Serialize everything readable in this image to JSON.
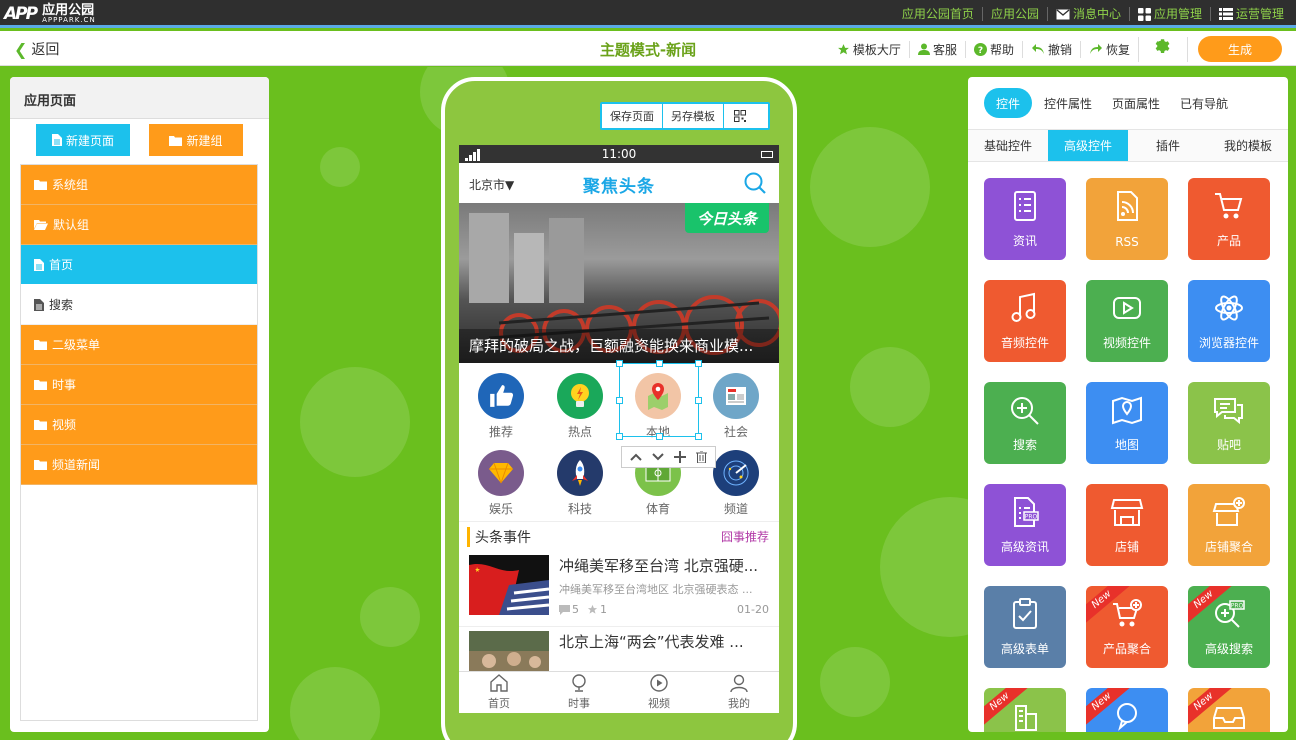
{
  "topbar": {
    "logo_mark": "APP",
    "logo_name": "应用公园",
    "logo_sub": "APPPARK.CN",
    "nav": [
      {
        "label": "应用公园首页",
        "icon": ""
      },
      {
        "label": "应用公园",
        "icon": ""
      },
      {
        "label": "消息中心",
        "icon": "envelope-icon"
      },
      {
        "label": "应用管理",
        "icon": "grid-icon"
      },
      {
        "label": "运营管理",
        "icon": "list-icon"
      }
    ]
  },
  "toolbar": {
    "back_label": "返回",
    "page_title": "主题模式-新闻",
    "tools": [
      {
        "label": "模板大厅",
        "icon": "star-icon"
      },
      {
        "label": "客服",
        "icon": "person-icon"
      },
      {
        "label": "帮助",
        "icon": "question-icon"
      },
      {
        "label": "撤销",
        "icon": "undo-icon"
      },
      {
        "label": "恢复",
        "icon": "redo-icon"
      }
    ],
    "generate_label": "生成"
  },
  "left_panel": {
    "title": "应用页面",
    "new_page_label": "新建页面",
    "new_group_label": "新建组",
    "items": [
      {
        "label": "系统组",
        "kind": "group"
      },
      {
        "label": "默认组",
        "kind": "group-open"
      },
      {
        "label": "首页",
        "kind": "page-active"
      },
      {
        "label": "搜索",
        "kind": "page"
      },
      {
        "label": "二级菜单",
        "kind": "group"
      },
      {
        "label": "时事",
        "kind": "group"
      },
      {
        "label": "视频",
        "kind": "group"
      },
      {
        "label": "频道新闻",
        "kind": "group"
      }
    ]
  },
  "phone": {
    "toolbar": {
      "save_label": "保存页面",
      "save_template_label": "另存模板"
    },
    "status_time": "11:00",
    "city": "北京市▼",
    "brand": "聚焦头条",
    "banner_tag": "今日头条",
    "banner_caption": "摩拜的破局之战，巨额融资能换来商业模...",
    "grid": [
      {
        "label": "推荐",
        "color": "#1f66b8"
      },
      {
        "label": "热点",
        "color": "#1aa85a"
      },
      {
        "label": "本地",
        "color": "#f2c5a6"
      },
      {
        "label": "社会",
        "color": "#6fa6c8"
      },
      {
        "label": "娱乐",
        "color": "#7a5b8c"
      },
      {
        "label": "科技",
        "color": "#243a6b"
      },
      {
        "label": "体育",
        "color": "#7cc24a"
      },
      {
        "label": "频道",
        "color": "#1d3f7a"
      }
    ],
    "section_title": "头条事件",
    "section_more": "囧事推荐",
    "news": [
      {
        "title": "冲绳美军移至台湾 北京强硬...",
        "desc": "冲绳美军移至台湾地区 北京强硬表态 ...",
        "comments": "5",
        "stars": "1",
        "date": "01-20"
      },
      {
        "title": "北京上海“两会”代表发难 ...",
        "desc": "",
        "comments": "",
        "stars": "",
        "date": ""
      }
    ],
    "tabs": [
      "首页",
      "时事",
      "视频",
      "我的"
    ]
  },
  "right_panel": {
    "tabs": [
      "控件",
      "控件属性",
      "页面属性",
      "已有导航"
    ],
    "subtabs": [
      "基础控件",
      "高级控件",
      "插件",
      "我的模板"
    ],
    "new_badge": "New",
    "controls": [
      {
        "label": "资讯",
        "color": "#8e52d6",
        "icon": "document-list-icon",
        "isNew": false
      },
      {
        "label": "RSS",
        "color": "#f2a33a",
        "icon": "rss-icon",
        "isNew": false
      },
      {
        "label": "产品",
        "color": "#ef5a30",
        "icon": "cart-icon",
        "isNew": false
      },
      {
        "label": "音频控件",
        "color": "#ef5a30",
        "icon": "music-icon",
        "isNew": false
      },
      {
        "label": "视频控件",
        "color": "#4caf50",
        "icon": "video-play-icon",
        "isNew": false
      },
      {
        "label": "浏览器控件",
        "color": "#3d8ef2",
        "icon": "atom-icon",
        "isNew": false
      },
      {
        "label": "搜索",
        "color": "#4caf50",
        "icon": "search-plus-icon",
        "isNew": false
      },
      {
        "label": "地图",
        "color": "#3d8ef2",
        "icon": "map-icon",
        "isNew": false
      },
      {
        "label": "贴吧",
        "color": "#8bc34a",
        "icon": "chat-bubbles-icon",
        "isNew": false
      },
      {
        "label": "高级资讯",
        "color": "#8e52d6",
        "icon": "pro-document-icon",
        "isNew": false
      },
      {
        "label": "店铺",
        "color": "#ef5a30",
        "icon": "shop-icon",
        "isNew": false
      },
      {
        "label": "店铺聚合",
        "color": "#f2a33a",
        "icon": "shop-plus-icon",
        "isNew": false
      },
      {
        "label": "高级表单",
        "color": "#5a7fa8",
        "icon": "clipboard-check-icon",
        "isNew": false
      },
      {
        "label": "产品聚合",
        "color": "#ef5a30",
        "icon": "cart-plus-icon",
        "isNew": true
      },
      {
        "label": "高级搜索",
        "color": "#4caf50",
        "icon": "pro-search-icon",
        "isNew": true
      },
      {
        "label": "",
        "color": "#8bc34a",
        "icon": "building-icon",
        "isNew": true
      },
      {
        "label": "",
        "color": "#3d8ef2",
        "icon": "chat-icon",
        "isNew": true
      },
      {
        "label": "",
        "color": "#f2a33a",
        "icon": "inbox-icon",
        "isNew": true
      }
    ]
  }
}
